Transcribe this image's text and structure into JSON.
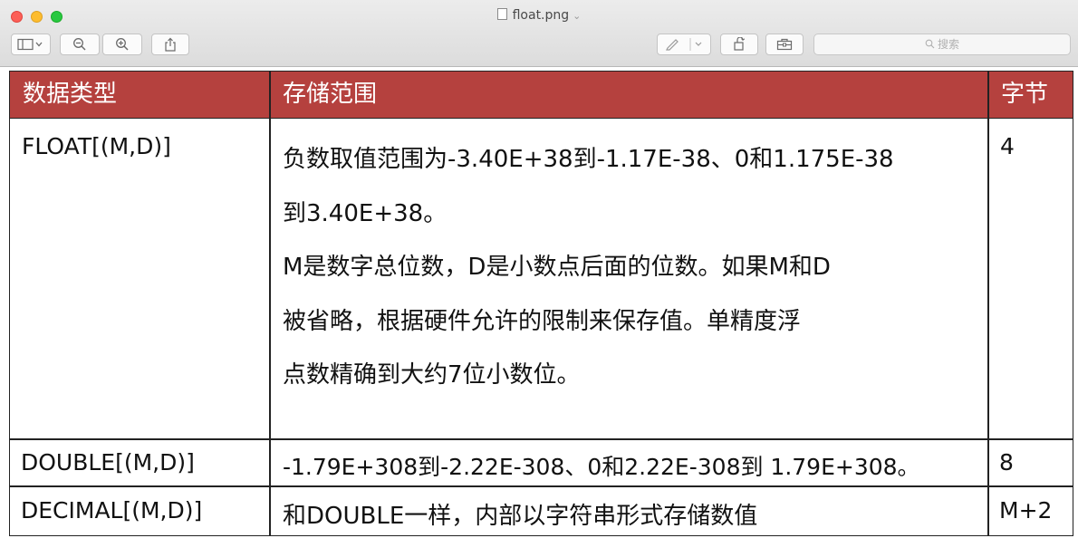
{
  "window": {
    "title": "float.png",
    "search_placeholder": "搜索"
  },
  "toolbar": {
    "sidebar_icon": "sidebar-icon",
    "zoom_out_icon": "zoom-out-icon",
    "zoom_in_icon": "zoom-in-icon",
    "share_icon": "share-icon",
    "markup_icon": "pen-icon",
    "rotate_icon": "rotate-icon",
    "toolbox_icon": "toolbox-icon"
  },
  "colors": {
    "header_bg": "#b5413e",
    "header_text": "#ffffff"
  },
  "table": {
    "headers": [
      "数据类型",
      "存储范围",
      "字节"
    ],
    "rows": [
      {
        "type": "FLOAT[(M,D)]",
        "range_lines": [
          "负数取值范围为-3.40E+38到-1.17E-38、0和1.175E-38",
          "到3.40E+38。",
          "M是数字总位数，D是小数点后面的位数。如果M和D",
          "被省略，根据硬件允许的限制来保存值。单精度浮",
          "点数精确到大约7位小数位。"
        ],
        "bytes": "4"
      },
      {
        "type": "DOUBLE[(M,D)]",
        "range": "-1.79E+308到-2.22E-308、0和2.22E-308到 1.79E+308。",
        "bytes": "8"
      },
      {
        "type": "DECIMAL[(M,D)]",
        "range": "和DOUBLE一样，内部以字符串形式存储数值",
        "bytes": "M+2"
      }
    ]
  }
}
